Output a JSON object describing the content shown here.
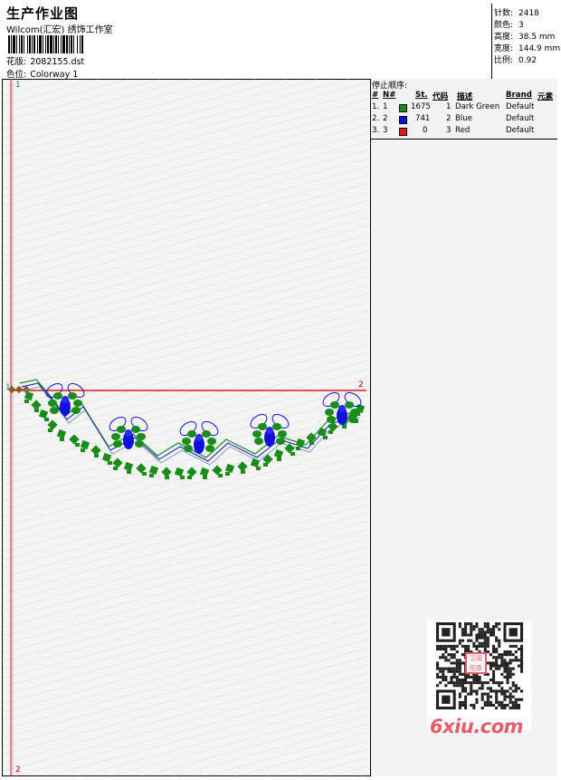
{
  "header": {
    "title": "生产作业图",
    "company": "Wilcom(汇宏) 绣饰工作室",
    "design_label": "花版:",
    "design_file": "2082155.dst",
    "colorway_label": "色位:",
    "colorway": "Colorway 1"
  },
  "stats": [
    {
      "label": "针数:",
      "value": "2418"
    },
    {
      "label": "颜色:",
      "value": "3"
    },
    {
      "label": "高度:",
      "value": "38.5 mm"
    },
    {
      "label": "宽度:",
      "value": "144.9 mm"
    },
    {
      "label": "比例:",
      "value": "0.92"
    }
  ],
  "canvas": {
    "marker_top": "1",
    "marker_right": "2",
    "marker_bottom": "2",
    "marker_start": "1"
  },
  "stop_sequence": {
    "heading": "停止顺序:",
    "columns": [
      "#",
      "N#",
      "St.",
      "代码",
      "描述",
      "Brand",
      "元素"
    ],
    "rows": [
      {
        "num": "1.",
        "n": "1",
        "color": "#1a8c1a",
        "stitches": "1675",
        "code": "1",
        "desc": "Dark Green",
        "brand": "Default"
      },
      {
        "num": "2.",
        "n": "2",
        "color": "#1010dd",
        "stitches": "741",
        "code": "2",
        "desc": "Blue",
        "brand": "Default"
      },
      {
        "num": "3.",
        "n": "3",
        "color": "#e01818",
        "stitches": "0",
        "code": "3",
        "desc": "Red",
        "brand": "Default"
      }
    ]
  },
  "watermark": {
    "seal_text": "汉阁图章",
    "logo": "6xiu.com"
  },
  "colors": {
    "green": "#1a8c1a",
    "blue": "#1010dd",
    "red": "#e01818"
  }
}
